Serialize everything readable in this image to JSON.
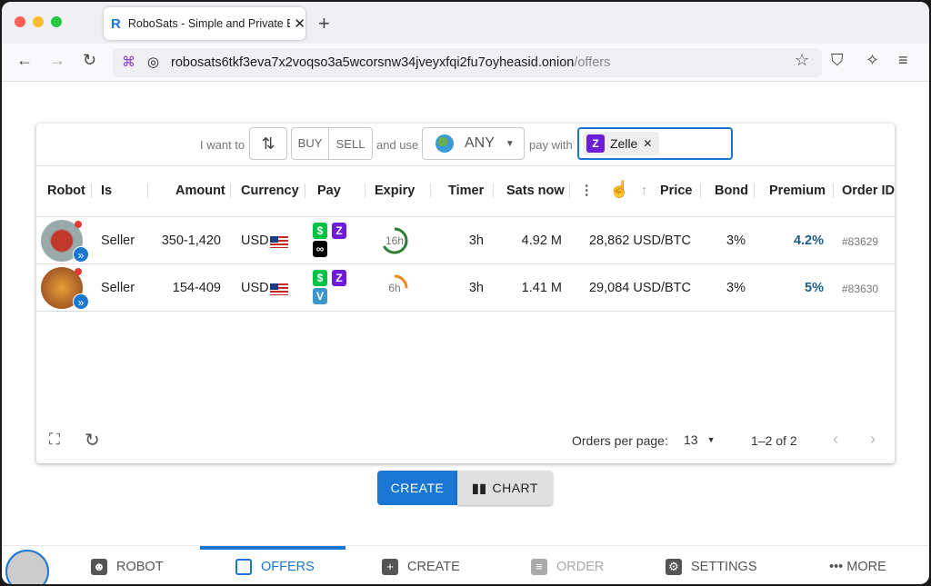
{
  "browser": {
    "tab_title": "RoboSats - Simple and Private B",
    "url_host": "robosats6tkf3eva7x2voqso3a5wcorsnw34jveyxfqi2fu7oyheasid.onion",
    "url_path": "/offers"
  },
  "filters": {
    "i_want_to": "I want to",
    "buy": "BUY",
    "sell": "SELL",
    "and_use": "and use",
    "currency": "ANY",
    "pay_with": "pay with",
    "payment_chip": "Zelle"
  },
  "columns": [
    "Robot",
    "Is",
    "Amount",
    "Currency",
    "Pay",
    "Expiry",
    "Timer",
    "Sats now",
    "Price",
    "Bond",
    "Premium",
    "Order ID"
  ],
  "rows": [
    {
      "is": "Seller",
      "amount": "350-1,420",
      "currency": "USD",
      "payment_methods": [
        "cash-app",
        "zelle",
        "paypal-like"
      ],
      "expiry": "16h",
      "expiry_fraction": 0.67,
      "expiry_color": "#2e7d32",
      "timer": "3h",
      "sats_now": "4.92 M",
      "price": "28,862 USD/BTC",
      "bond": "3%",
      "premium": "4.2%",
      "order_id": "#83629"
    },
    {
      "is": "Seller",
      "amount": "154-409",
      "currency": "USD",
      "payment_methods": [
        "cash-app",
        "zelle",
        "venmo"
      ],
      "expiry": "6h",
      "expiry_fraction": 0.25,
      "expiry_color": "#ef8a1a",
      "timer": "3h",
      "sats_now": "1.41 M",
      "price": "29,084 USD/BTC",
      "bond": "3%",
      "premium": "5%",
      "order_id": "#83630"
    }
  ],
  "footer": {
    "orders_per_page_label": "Orders per page:",
    "orders_per_page": "13",
    "range": "1–2 of 2"
  },
  "actions": {
    "create": "CREATE",
    "chart": "CHART"
  },
  "nav": {
    "robot": "ROBOT",
    "offers": "OFFERS",
    "create": "CREATE",
    "order": "ORDER",
    "settings": "SETTINGS",
    "more": "MORE"
  },
  "colors": {
    "accent": "#1976d2",
    "premium": "#1a5e8c"
  }
}
